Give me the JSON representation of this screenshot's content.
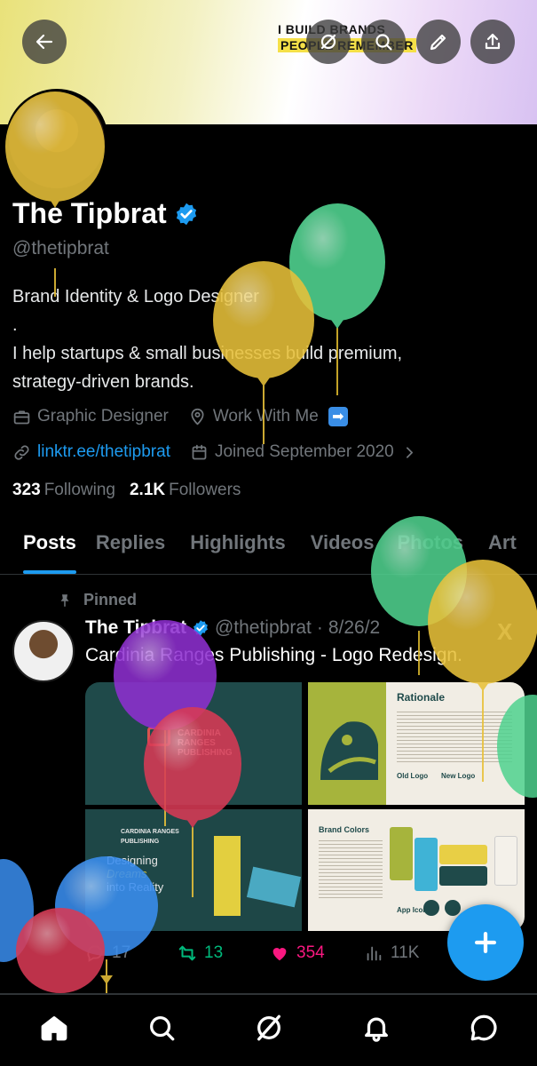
{
  "banner": {
    "line1": "I BUILD BRANDS",
    "line2": "PEOPLE REMEMBER",
    "back_icon": "arrow-left-icon",
    "icons": [
      "circle-slash-icon",
      "search-icon",
      "pencil-icon",
      "share-icon"
    ]
  },
  "profile": {
    "name": "The Tipbrat",
    "handle": "@thetipbrat",
    "bio_line1": "Brand Identity & Logo Designer",
    "bio_line2": ".",
    "bio_line3": "I help startups & small businesses build premium,",
    "bio_line4": "strategy-driven brands.",
    "category": "Graphic Designer",
    "location": "Work With Me",
    "location_emoji": "➡",
    "website": "linktr.ee/thetipbrat",
    "joined": "Joined September 2020",
    "following_count": "323",
    "following_label": "Following",
    "followers_count": "2.1K",
    "followers_label": "Followers"
  },
  "tabs": [
    "Posts",
    "Replies",
    "Highlights",
    "Videos",
    "Photos",
    "Art"
  ],
  "active_tab": "Posts",
  "post": {
    "pinned_label": "Pinned",
    "author": "The Tipbrat",
    "handle": "@thetipbrat",
    "dot": "·",
    "date": "8/26/2",
    "x_label": "X",
    "text": "Cardinia Ranges Publishing - Logo Redesign.",
    "media": {
      "tile1_label": "CARDINIA RANGES PUBLISHING",
      "tile2_title": "Rationale",
      "tile2_old": "Old Logo",
      "tile2_new": "New Logo",
      "tile3_brand": "CARDINIA RANGES PUBLISHING",
      "tile3_line1": "Designing",
      "tile3_line2": "Dreams",
      "tile3_line3": "into Reality",
      "tile4_title": "Brand Colors",
      "tile4_app": "App Icons"
    },
    "replies": "17",
    "reposts": "13",
    "likes": "354",
    "views": "11K"
  },
  "colors": {
    "accent": "#1d9bf0",
    "like": "#f91880",
    "repost": "#00ba7c",
    "balloon_yellow": "#e8c13a",
    "balloon_green": "#4fd18e",
    "balloon_purple": "#8e2fd0",
    "balloon_red": "#d83a55",
    "balloon_blue": "#3a8ef0"
  },
  "bottom_nav": [
    "home-icon",
    "search-icon",
    "grok-icon",
    "bell-icon",
    "messages-icon"
  ]
}
